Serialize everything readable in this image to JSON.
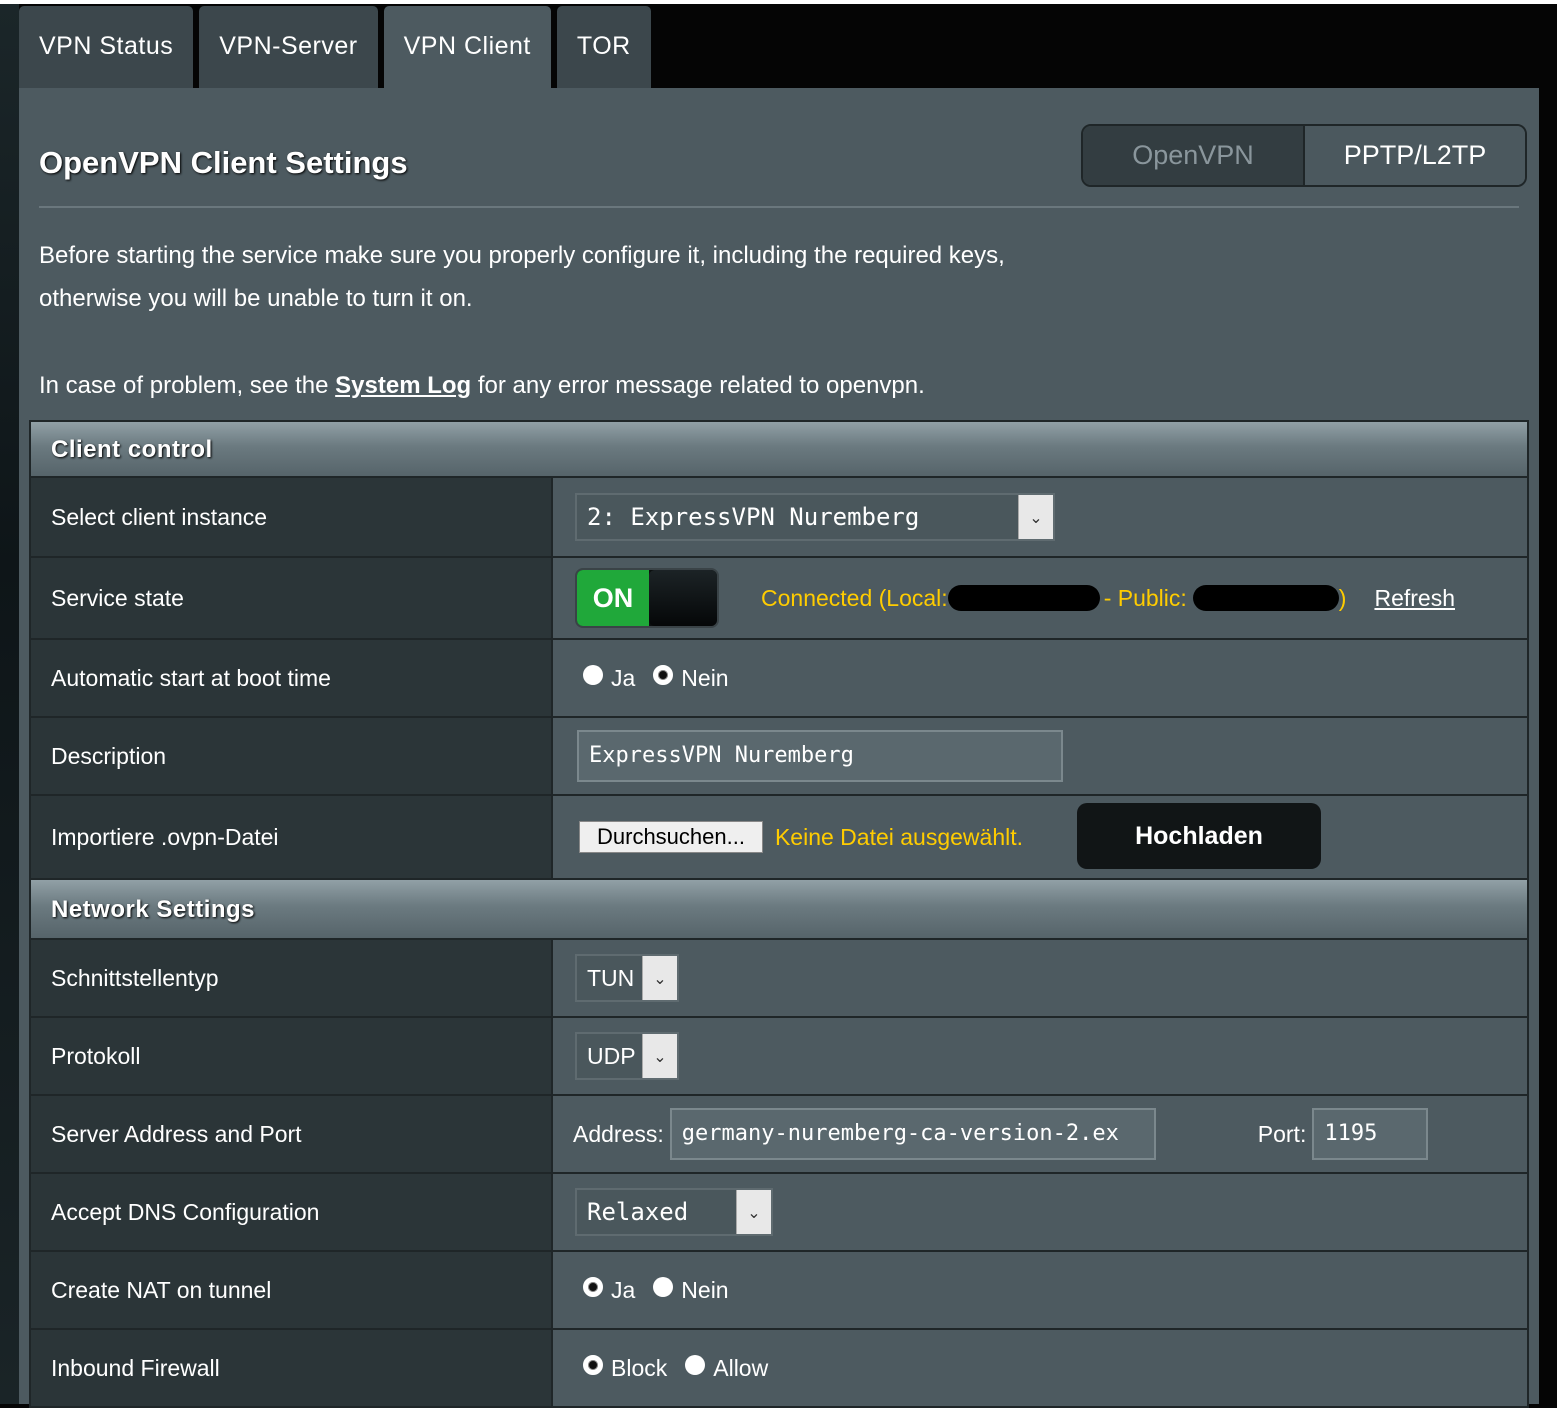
{
  "tabs": [
    {
      "label": "VPN Status"
    },
    {
      "label": "VPN-Server"
    },
    {
      "label": "VPN Client",
      "active": true
    },
    {
      "label": "TOR"
    }
  ],
  "page": {
    "title": "OpenVPN Client Settings",
    "mode_buttons": {
      "openvpn": "OpenVPN",
      "pptp": "PPTP/L2TP"
    },
    "intro_line1": "Before starting the service make sure you properly configure it, including the required keys,",
    "intro_line2": "otherwise you will be unable to turn it on.",
    "problem_prefix": "In case of problem, see the ",
    "problem_link": "System Log",
    "problem_suffix": " for any error message related to openvpn."
  },
  "client_control": {
    "header": "Client control",
    "instance": {
      "label": "Select client instance",
      "value": "2: ExpressVPN Nuremberg"
    },
    "service_state": {
      "label": "Service state",
      "toggle": "ON",
      "status_prefix": "Connected (Local:",
      "status_mid": "- Public:",
      "status_suffix": ")",
      "refresh": "Refresh"
    },
    "autostart": {
      "label": "Automatic start at boot time",
      "options": [
        "Ja",
        "Nein"
      ],
      "selected": "Nein"
    },
    "description": {
      "label": "Description",
      "value": "ExpressVPN Nuremberg"
    },
    "import": {
      "label": "Importiere .ovpn-Datei",
      "browse": "Durchsuchen...",
      "file_status": "Keine Datei ausgewählt.",
      "upload": "Hochladen"
    }
  },
  "network_settings": {
    "header": "Network Settings",
    "iface": {
      "label": "Schnittstellentyp",
      "value": "TUN"
    },
    "protocol": {
      "label": "Protokoll",
      "value": "UDP"
    },
    "server": {
      "label": "Server Address and Port",
      "address_label": "Address:",
      "address": "germany-nuremberg-ca-version-2.ex",
      "port_label": "Port:",
      "port": "1195"
    },
    "dns": {
      "label": "Accept DNS Configuration",
      "value": "Relaxed"
    },
    "nat": {
      "label": "Create NAT on tunnel",
      "options": [
        "Ja",
        "Nein"
      ],
      "selected": "Ja"
    },
    "firewall": {
      "label": "Inbound Firewall",
      "options": [
        "Block",
        "Allow"
      ],
      "selected": "Block"
    }
  },
  "colors": {
    "accent_yellow": "#ffcc00",
    "toggle_green": "#20a83a",
    "panel": "#4d5a60",
    "label_bg": "#2b3538"
  },
  "icons": [
    "chevron-down-icon",
    "radio-icon"
  ]
}
